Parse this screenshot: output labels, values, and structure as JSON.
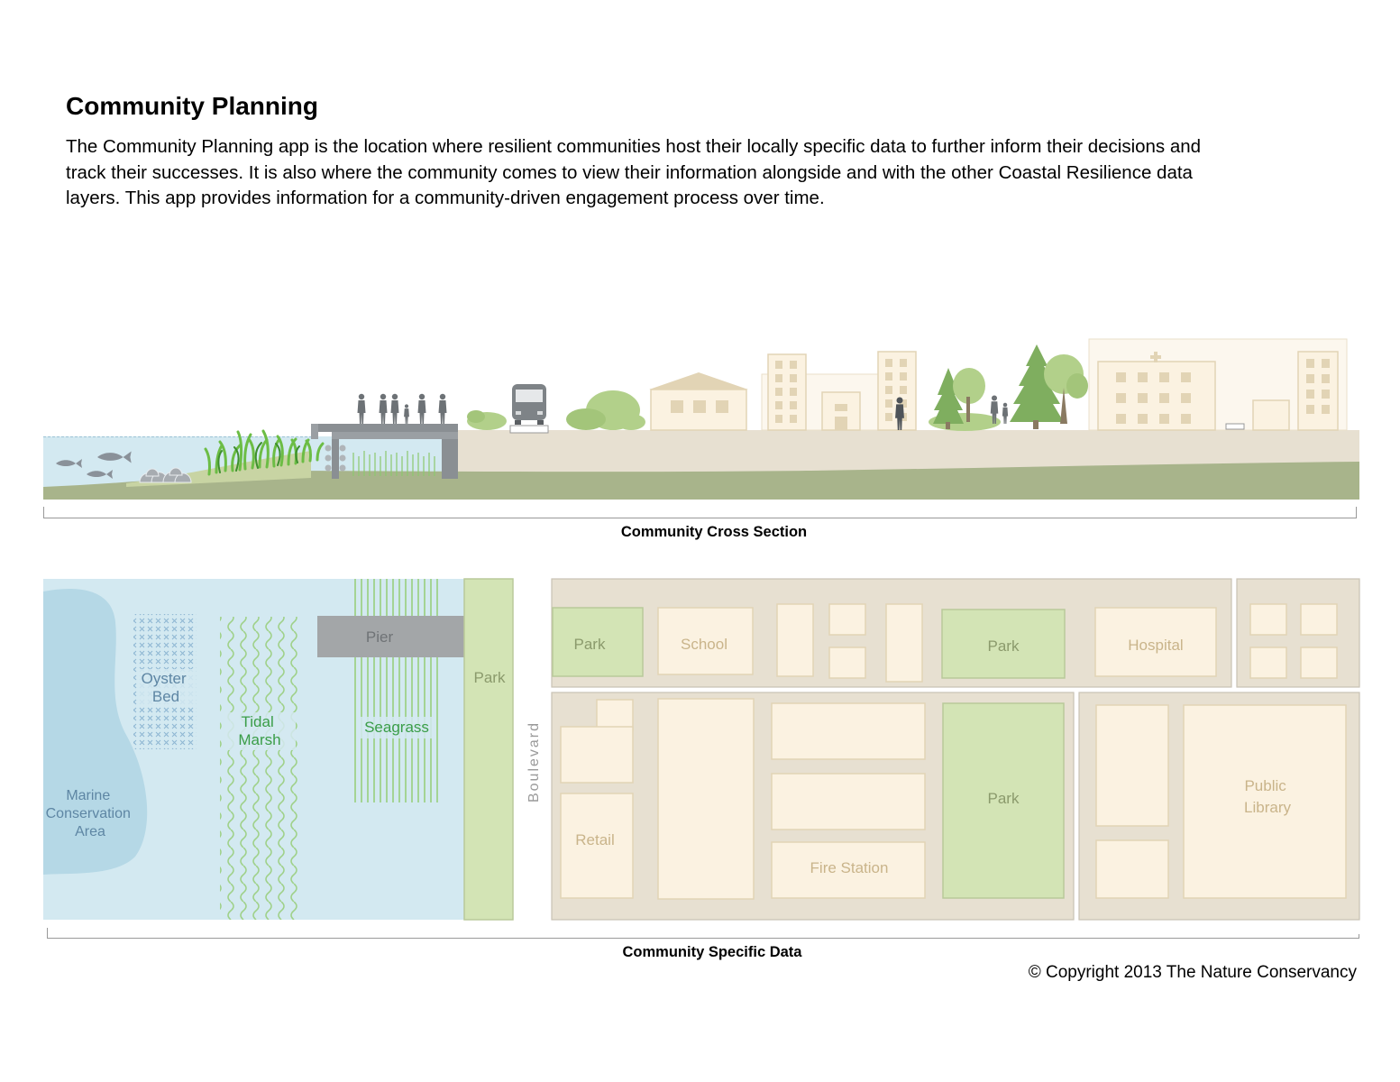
{
  "header": {
    "title": "Community Planning",
    "description": "The Community Planning app is the location where resilient communities host their locally specific data to further inform their decisions and track their successes.  It is also where the community comes to view their information alongside and with the other Coastal Resilience data layers.  This app provides information for a community-driven engagement process over time."
  },
  "cross_section": {
    "caption": "Community Cross Section",
    "icons": [
      "fish-icon",
      "oyster-icon",
      "marsh-grass-icon",
      "pier",
      "person-icon",
      "bus-icon",
      "shrub-icon",
      "house-icon",
      "office-building-icon",
      "tree-icon",
      "hospital-icon"
    ]
  },
  "map": {
    "caption": "Community Specific Data",
    "labels": {
      "marine_conservation": [
        "Marine",
        "Conservation",
        "Area"
      ],
      "oyster_bed": [
        "Oyster",
        "Bed"
      ],
      "tidal_marsh": [
        "Tidal",
        "Marsh"
      ],
      "seagrass": "Seagrass",
      "pier": "Pier",
      "park_strip": "Park",
      "boulevard": "Boulevard",
      "park_1": "Park",
      "school": "School",
      "park_2": "Park",
      "hospital": "Hospital",
      "retail": "Retail",
      "fire_station": "Fire Station",
      "park_3": "Park",
      "public_library": [
        "Public",
        "Library"
      ]
    }
  },
  "footer": {
    "copyright": "© Copyright 2013 The Nature Conservancy"
  },
  "colors": {
    "water": "#d3e9f1",
    "deep_water": "#b5d8e6",
    "park_green": "#d3e4b5",
    "building_fill": "#fbf2e1",
    "block_fill": "#e7e0d1",
    "ground_green": "#a8b48b",
    "pier_gray": "#a3a6a8"
  }
}
